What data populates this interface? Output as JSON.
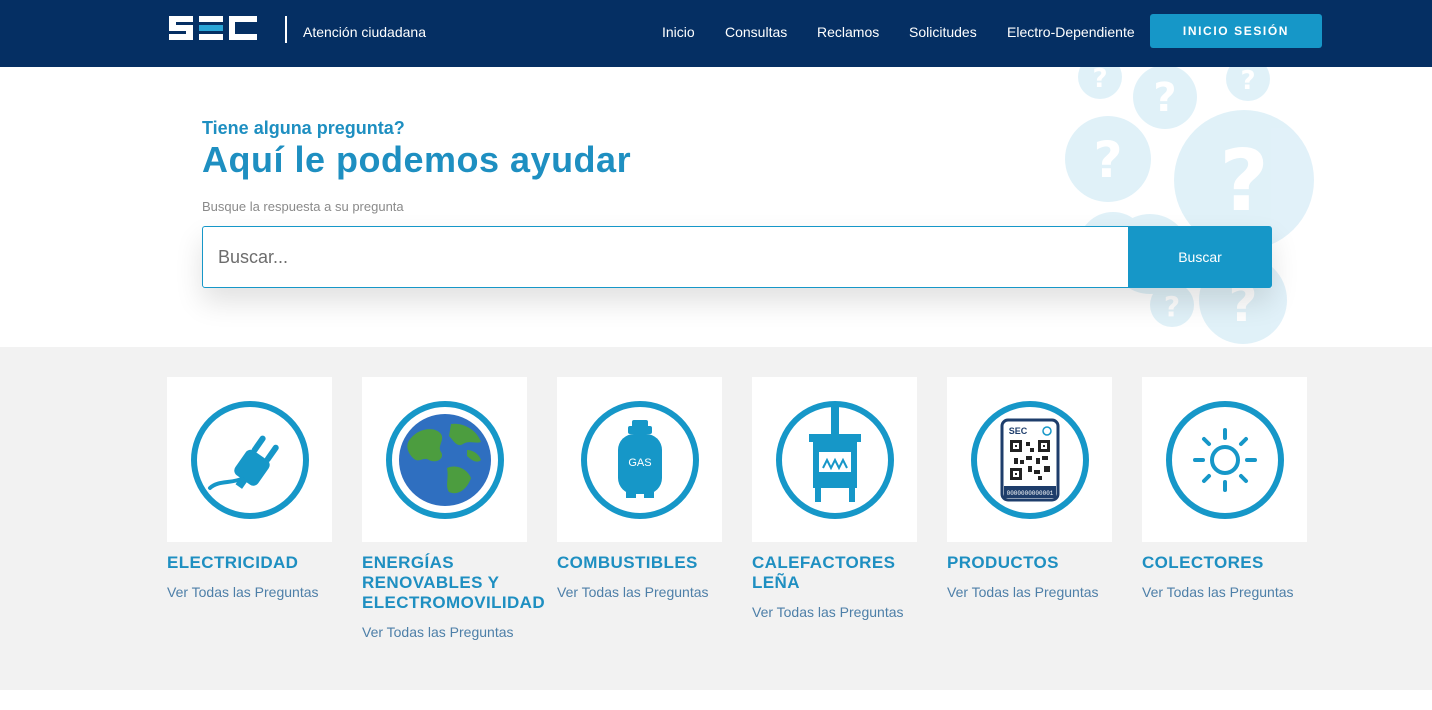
{
  "header": {
    "logo_text": "SEC",
    "tagline": "Atención ciudadana",
    "nav": [
      "Inicio",
      "Consultas",
      "Reclamos",
      "Solicitudes",
      "Electro-Dependiente"
    ],
    "login_label": "INICIO SESIÓN",
    "bg_color": "#052f63",
    "accent_color": "#1697c8"
  },
  "hero": {
    "kicker": "Tiene alguna pregunta?",
    "title": "Aquí le podemos ayudar",
    "hint": "Busque la respuesta a su pregunta",
    "search_placeholder": "Buscar...",
    "search_button": "Buscar"
  },
  "categories": [
    {
      "title_lines": [
        "ELECTRICIDAD"
      ],
      "link": "Ver Todas las Preguntas",
      "icon": "plug-icon"
    },
    {
      "title_lines": [
        "ENERGÍAS",
        "RENOVABLES Y",
        "ELECTROMOVILIDAD"
      ],
      "link": "Ver Todas las Preguntas",
      "icon": "globe-icon"
    },
    {
      "title_lines": [
        "COMBUSTIBLES"
      ],
      "link": "Ver Todas las Preguntas",
      "icon": "gas-cylinder-icon",
      "icon_text": "GAS"
    },
    {
      "title_lines": [
        "CALEFACTORES",
        "LEÑA"
      ],
      "link": "Ver Todas las Preguntas",
      "icon": "wood-stove-icon"
    },
    {
      "title_lines": [
        "PRODUCTOS"
      ],
      "link": "Ver Todas las Preguntas",
      "icon": "qr-label-icon",
      "icon_text": "SEC",
      "icon_serial": "0000000000001"
    },
    {
      "title_lines": [
        "COLECTORES"
      ],
      "link": "Ver Todas las Preguntas",
      "icon": "sun-icon"
    }
  ]
}
